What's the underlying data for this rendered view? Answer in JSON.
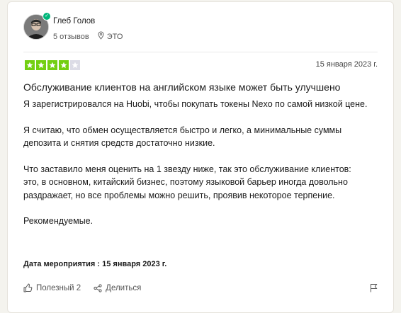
{
  "reviewer": {
    "name": "Глеб Голов",
    "reviews_count": "5 отзывов",
    "country": "ЭТО",
    "avatar_icon": "user-photo",
    "verified_icon": "check-icon"
  },
  "review": {
    "rating": 4,
    "rating_max": 5,
    "rating_color": "#73cf11",
    "date": "15 января 2023 г.",
    "title": "Обслуживание клиентов на английском языке может быть улучшено",
    "paragraphs": [
      "Я зарегистрировался на Huobi, чтобы покупать токены Nexo по самой низкой цене.",
      "Я считаю, что обмен осуществляется быстро и легко, а минимальные суммы депозита и снятия средств достаточно низкие.",
      "Что заставило меня оценить на 1 звезду ниже, так это обслуживание клиентов:\nэто, в основном, китайский бизнес, поэтому языковой барьер иногда довольно раздражает, но все проблемы можно решить, проявив некоторое терпение.",
      "Рекомендуемые."
    ],
    "experience_label": "Дата мероприятия :",
    "experience_date": "15 января 2023 г."
  },
  "footer": {
    "useful_label": "Полезный 2",
    "share_label": "Делиться",
    "useful_icon": "thumbs-up-icon",
    "share_icon": "share-icon",
    "report_icon": "flag-icon"
  }
}
